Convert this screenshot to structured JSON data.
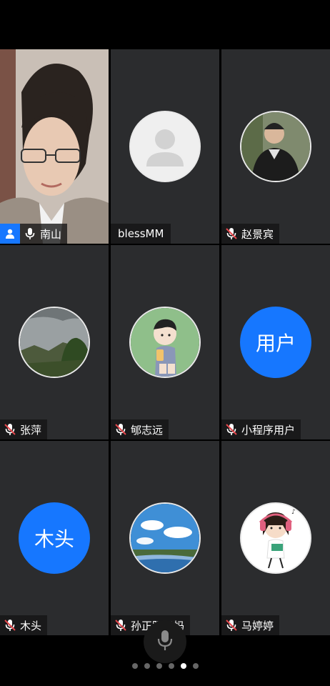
{
  "participants": [
    {
      "name": "南山",
      "type": "video",
      "mic": "on",
      "host": true
    },
    {
      "name": "blessMM",
      "type": "placeholder",
      "mic": "none"
    },
    {
      "name": "赵景宾",
      "type": "photo-person",
      "mic": "muted"
    },
    {
      "name": "张萍",
      "type": "photo-landscape",
      "mic": "muted"
    },
    {
      "name": "郇志远",
      "type": "cartoon-boy",
      "mic": "muted"
    },
    {
      "name": "小程序用户",
      "type": "text",
      "avatar_text": "用户",
      "mic": "muted"
    },
    {
      "name": "木头",
      "type": "text",
      "avatar_text": "木头",
      "mic": "muted"
    },
    {
      "name": "孙正阳妈妈",
      "type": "photo-sky",
      "mic": "muted"
    },
    {
      "name": "马婷婷",
      "type": "cartoon-girl",
      "mic": "muted"
    }
  ],
  "pager": {
    "count": 6,
    "active_index": 4
  },
  "colors": {
    "accent": "#1677ff",
    "muted_red": "#e5484d",
    "tile_bg": "#2b2c2e"
  }
}
